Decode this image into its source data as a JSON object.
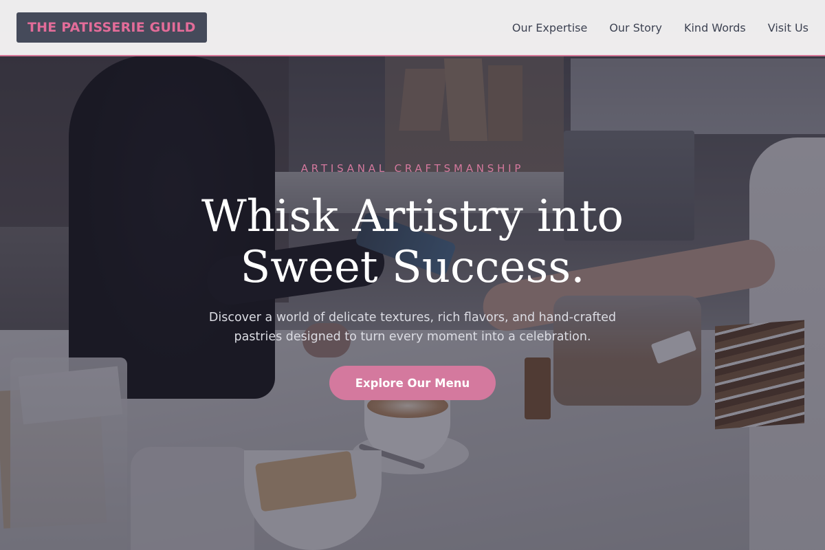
{
  "header": {
    "logo": "THE PATISSERIE GUILD",
    "nav": [
      {
        "label": "Our Expertise"
      },
      {
        "label": "Our Story"
      },
      {
        "label": "Kind Words"
      },
      {
        "label": "Visit Us"
      }
    ]
  },
  "hero": {
    "eyebrow": "ARTISANAL CRAFTSMANSHIP",
    "headline_line1": "Whisk Artistry into",
    "headline_line2": "Sweet Success.",
    "subtext_line1": "Discover a world of delicate textures, rich flavors, and hand-crafted",
    "subtext_line2": "pastries designed to turn every moment into a celebration.",
    "cta_label": "Explore Our Menu"
  },
  "colors": {
    "accent": "#d4799e",
    "logo_bg": "#454a5a",
    "logo_text": "#e36c99",
    "nav_text": "#3d4252",
    "header_bg": "#f4f3f3"
  }
}
